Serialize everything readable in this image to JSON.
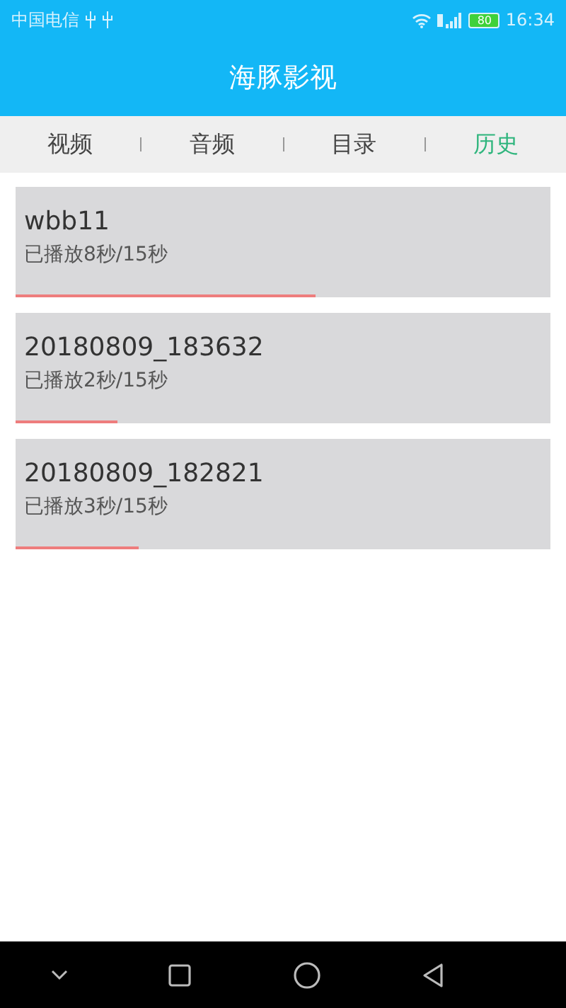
{
  "status_bar": {
    "carrier": "中国电信",
    "battery": "80",
    "time": "16:34"
  },
  "header": {
    "title": "海豚影视"
  },
  "tabs": [
    {
      "label": "视频",
      "selected": false
    },
    {
      "label": "音频",
      "selected": false
    },
    {
      "label": "目录",
      "selected": false
    },
    {
      "label": "历史",
      "selected": true
    }
  ],
  "history": [
    {
      "title": "wbb11",
      "progress": "已播放8秒/15秒",
      "level": 0.56
    },
    {
      "title": "20180809_183632",
      "progress": "已播放2秒/15秒",
      "level": 0.19
    },
    {
      "title": "20180809_182821",
      "progress": "已播放3秒/15秒",
      "level": 0.23
    }
  ]
}
